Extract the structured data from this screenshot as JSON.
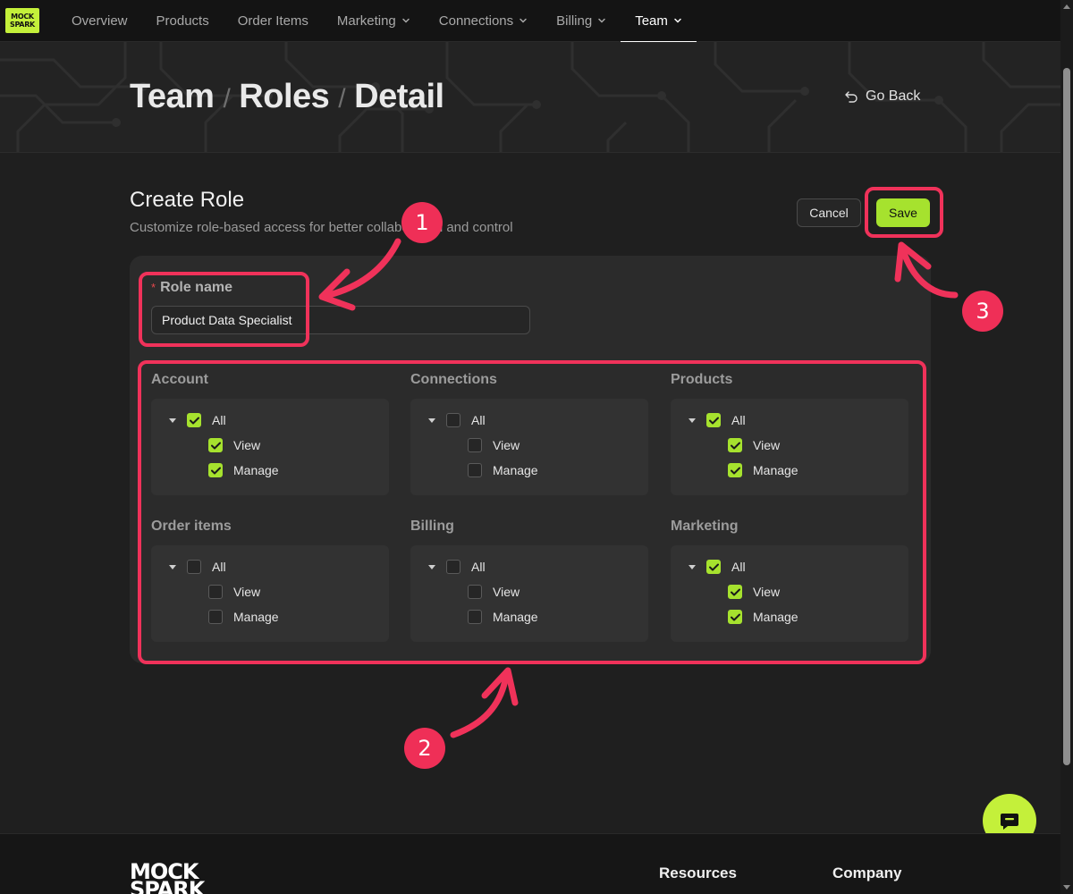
{
  "brand": {
    "logo_line1": "MOCK",
    "logo_line2": "SPARK"
  },
  "nav": {
    "items": [
      {
        "label": "Overview",
        "dropdown": false
      },
      {
        "label": "Products",
        "dropdown": false
      },
      {
        "label": "Order Items",
        "dropdown": false
      },
      {
        "label": "Marketing",
        "dropdown": true
      },
      {
        "label": "Connections",
        "dropdown": true
      },
      {
        "label": "Billing",
        "dropdown": true
      },
      {
        "label": "Team",
        "dropdown": true,
        "active": true
      }
    ]
  },
  "hero": {
    "breadcrumb": [
      "Team",
      "Roles",
      "Detail"
    ],
    "go_back": "Go Back"
  },
  "form": {
    "title": "Create Role",
    "subtitle": "Customize role-based access for better collaboration and control",
    "cancel_label": "Cancel",
    "save_label": "Save",
    "role_name_label": "Role name",
    "role_name_required_mark": "*",
    "role_name_value": "Product Data Specialist"
  },
  "permissions": [
    {
      "group": "Account",
      "all": true,
      "view": true,
      "manage": true
    },
    {
      "group": "Connections",
      "all": false,
      "view": false,
      "manage": false
    },
    {
      "group": "Products",
      "all": true,
      "view": true,
      "manage": true
    },
    {
      "group": "Order items",
      "all": false,
      "view": false,
      "manage": false
    },
    {
      "group": "Billing",
      "all": false,
      "view": false,
      "manage": false
    },
    {
      "group": "Marketing",
      "all": true,
      "view": true,
      "manage": true
    }
  ],
  "permission_labels": {
    "all": "All",
    "view": "View",
    "manage": "Manage"
  },
  "annotations": {
    "badge1": "1",
    "badge2": "2",
    "badge3": "3"
  },
  "footer": {
    "logo_line1": "MOCK",
    "logo_line2": "SPARK",
    "col1": "Resources",
    "col2": "Company"
  },
  "colors": {
    "accent": "#a6e22e",
    "annotation": "#f0325a",
    "background": "#1f1f1f"
  },
  "icons": {
    "go_back": "undo-arrow-icon",
    "chat": "chat-bubble-icon",
    "checkbox": "check-icon",
    "tree_toggle": "caret-down-icon"
  }
}
